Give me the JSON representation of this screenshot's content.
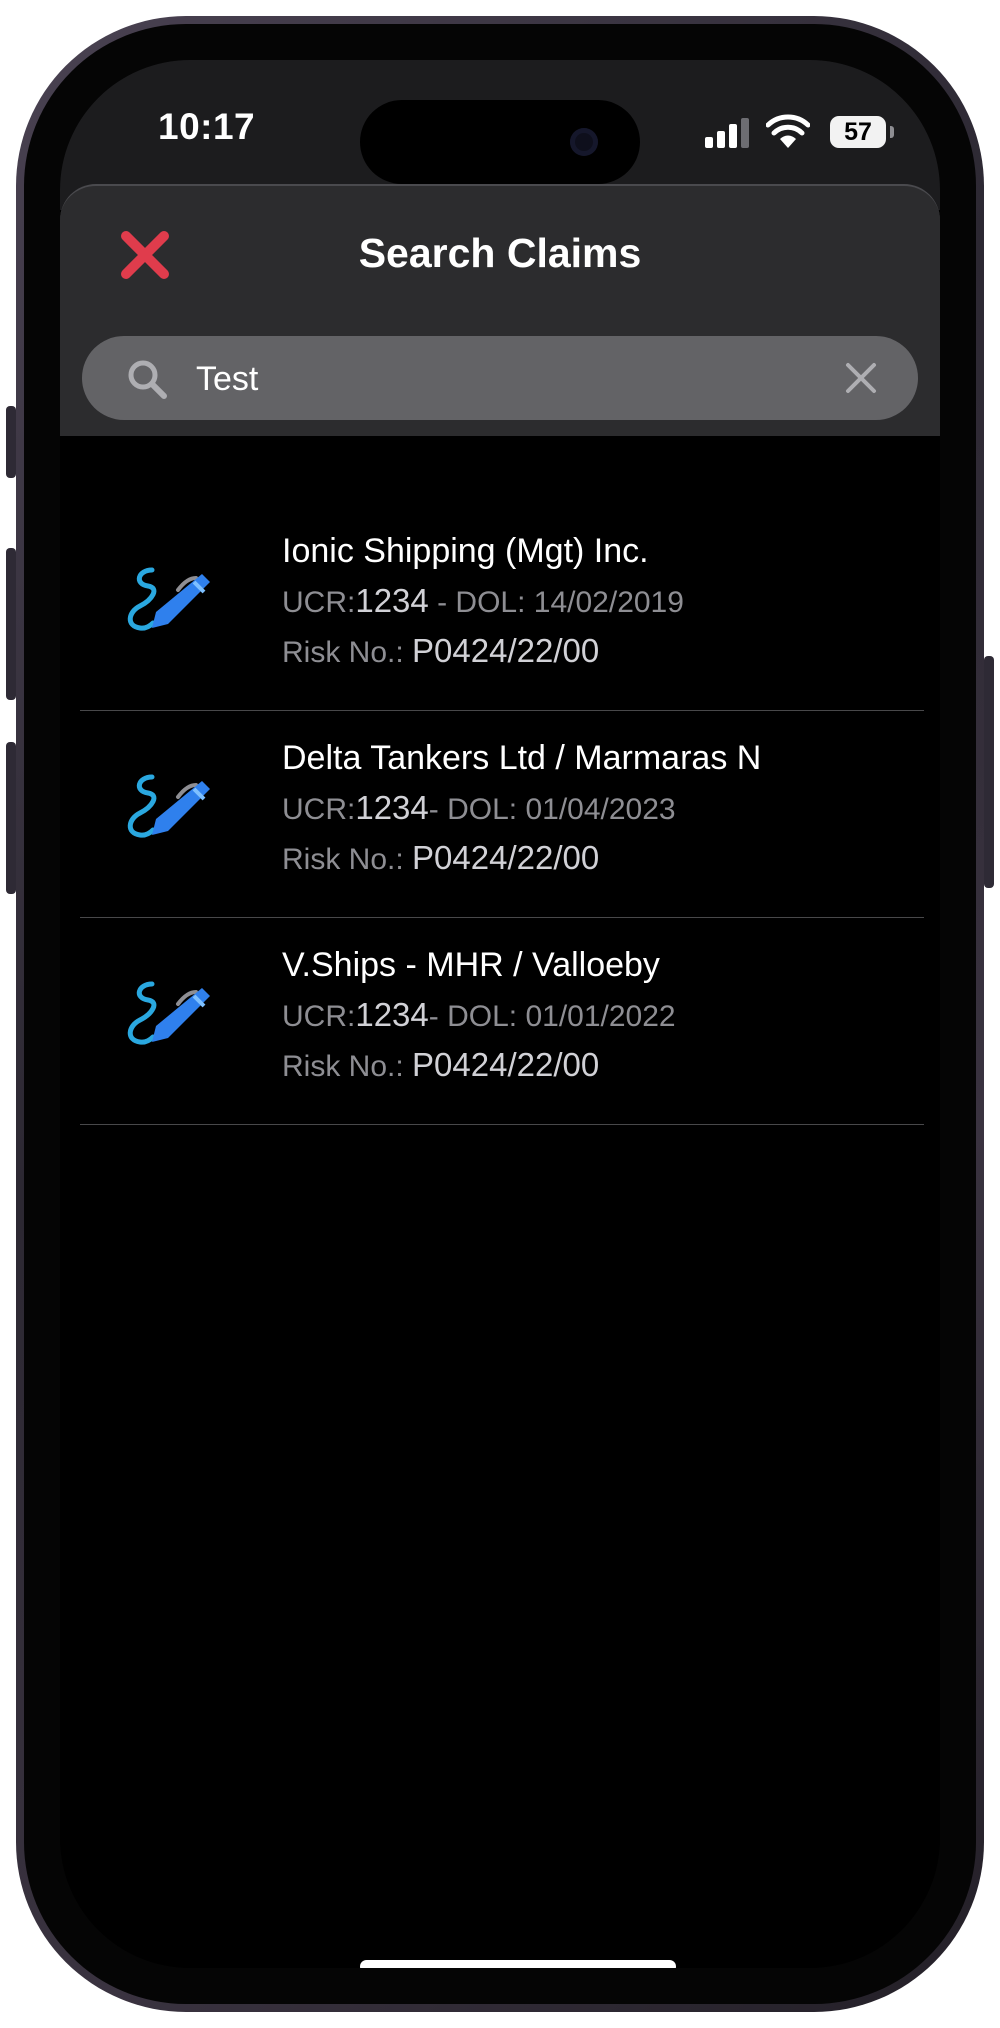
{
  "status_bar": {
    "time": "10:17",
    "battery_level": "57"
  },
  "sheet": {
    "title": "Search Claims",
    "close_icon": "close-x-icon",
    "search": {
      "value": "Test",
      "placeholder": "",
      "search_icon": "search-icon",
      "clear_icon": "clear-icon"
    }
  },
  "claims": [
    {
      "icon": "signature-pen-icon",
      "name": "Ionic Shipping (Mgt) Inc.",
      "ucr_label": "UCR:",
      "ucr": "1234",
      "dol_text": " - DOL: 14/02/2019",
      "risk_label": "Risk No.:",
      "risk_no": "P0424/22/00"
    },
    {
      "icon": "signature-pen-icon",
      "name": "Delta Tankers Ltd / Marmaras N",
      "ucr_label": "UCR:",
      "ucr": "1234",
      "dol_text": "- DOL: 01/04/2023",
      "risk_label": "Risk No.:",
      "risk_no": "P0424/22/00"
    },
    {
      "icon": "signature-pen-icon",
      "name": "V.Ships - MHR / Valloeby",
      "ucr_label": "UCR:",
      "ucr": "1234",
      "dol_text": "- DOL: 01/01/2022",
      "risk_label": "Risk No.:",
      "risk_no": "P0424/22/00"
    }
  ],
  "colors": {
    "close_red": "#e03c4c",
    "pen_blue": "#2f80ed",
    "wire_blue": "#2aa8e0",
    "sheet_background": "#2c2c2e",
    "search_background": "#636366",
    "secondary_text": "#8e8e93"
  }
}
